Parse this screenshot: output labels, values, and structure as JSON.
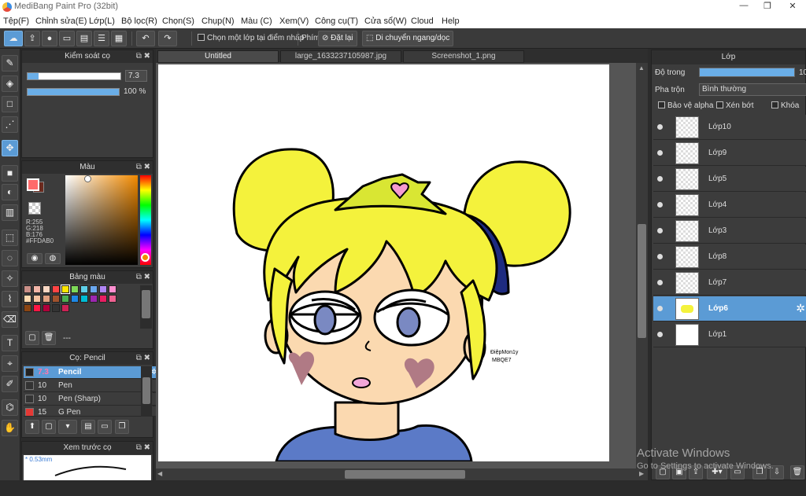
{
  "app": {
    "title": "MediBang Paint Pro (32bit)",
    "min": "—",
    "restore": "❐",
    "close": "✕"
  },
  "menu": [
    "Tệp(F)",
    "Chỉnh sửa(E)",
    "Lớp(L)",
    "Bộ lọc(R)",
    "Chọn(S)",
    "Chụp(N)",
    "Màu (C)",
    "Xem(V)",
    "Công cụ(T)",
    "Cửa sổ(W)",
    "Cloud",
    "Help"
  ],
  "toolbar": {
    "select_on_click": "Chọn một lớp tại điểm nhấp",
    "keys_label": "Phím",
    "reset": "Đặt lại",
    "move_hv": "Di chuyển ngang/dọc"
  },
  "brush_control": {
    "title": "Kiểm soát cọ",
    "size_value": "7.3",
    "size_fraction": 0.12,
    "opacity_label": "100 %",
    "opacity_fraction": 1.0
  },
  "color_panel": {
    "title": "Màu",
    "r": "R:255",
    "g": "G:218",
    "b": "B:176",
    "hex": "#FFDAB0",
    "primary": "#FF6B6B",
    "secondary": "#6B2A1E"
  },
  "palette_panel": {
    "title": "Bảng màu",
    "swatches": [
      "#c98f87",
      "#f2b6a8",
      "#f9d7c3",
      "#ff4444",
      "#ffe600",
      "#7ed957",
      "#5ecfe8",
      "#6aa8f0",
      "#b085f5",
      "#ff8fd0",
      "#ffdab0",
      "#f5c3a2",
      "#e0a080",
      "#a0522d",
      "#4caf50",
      "#1e88e5",
      "#00bcd4",
      "#9c27b0",
      "#e91e63",
      "#f06292",
      "#8b4513",
      "#ff1744",
      "#b0003a",
      "#333333",
      "#cc2255"
    ],
    "footer_text": "---"
  },
  "brush_panel": {
    "title": "Cọ: Pencil",
    "items": [
      {
        "size": "7.3",
        "name": "Pencil",
        "color": "#222222"
      },
      {
        "size": "10",
        "name": "Pen",
        "color": "#333333"
      },
      {
        "size": "10",
        "name": "Pen (Sharp)",
        "color": "#333333"
      },
      {
        "size": "15",
        "name": "G Pen",
        "color": "#e53935"
      }
    ]
  },
  "brush_preview": {
    "title": "Xem trước cọ",
    "size": "* 0.53mm"
  },
  "tabs": [
    "Untitled",
    "large_1633237105987.jpg",
    "Screenshot_1.png"
  ],
  "layer_panel": {
    "title": "Lớp",
    "opacity_label": "Độ trong",
    "opacity_value": "10",
    "blend_label": "Pha trộn",
    "blend_value": "Bình thường",
    "protect_alpha": "Bảo vệ alpha",
    "clipping": "Xén bớt",
    "lock": "Khóa",
    "layers": [
      "Lớp10",
      "Lớp9",
      "Lớp5",
      "Lớp4",
      "Lớp3",
      "Lớp8",
      "Lớp7",
      "Lớp6",
      "Lớp1"
    ]
  },
  "signature": {
    "line1": "ĐiệpMon1y",
    "line2": "MBQE7"
  },
  "watermark": {
    "line1": "Activate Windows",
    "line2": "Go to Settings to activate Windows."
  },
  "colors": {
    "hair": "#f4f23c",
    "skin": "#fbd9b0",
    "blush": "#b07a85",
    "scrunchie": "#1e2b80",
    "dress": "#5b7ac7",
    "accent": "#5b9bd5"
  }
}
